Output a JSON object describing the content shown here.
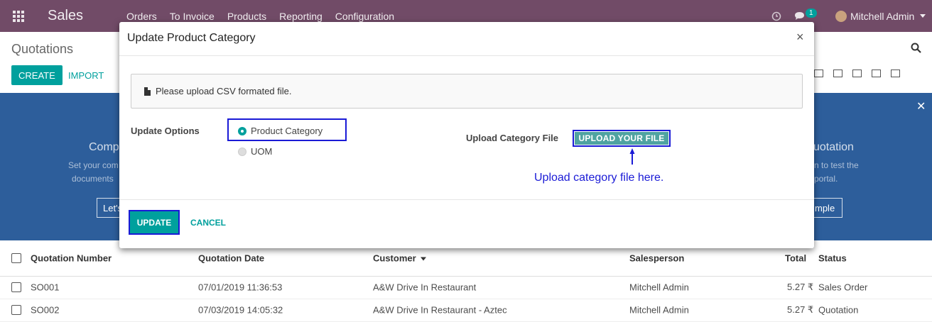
{
  "navbar": {
    "app_name": "Sales",
    "menu": [
      "Orders",
      "To Invoice",
      "Products",
      "Reporting",
      "Configuration"
    ],
    "chat_badge": "1",
    "user_name": "Mitchell Admin"
  },
  "control_panel": {
    "breadcrumb": "Quotations",
    "create_label": "CREATE",
    "import_label": "IMPORT"
  },
  "banner": {
    "left_title": "Comp",
    "left_text_1": "Set your com",
    "left_text_2": "documents",
    "left_button": "Let's",
    "right_title": "uotation",
    "right_text_1": "n to test the",
    "right_text_2": "portal.",
    "right_button": "mple"
  },
  "list": {
    "headers": [
      "Quotation Number",
      "Quotation Date",
      "Customer",
      "Salesperson",
      "Total",
      "Status"
    ],
    "rows": [
      {
        "number": "SO001",
        "date": "07/01/2019 11:36:53",
        "customer": "A&W Drive In Restaurant",
        "salesperson": "Mitchell Admin",
        "total": "5.27 ₹",
        "status": "Sales Order"
      },
      {
        "number": "SO002",
        "date": "07/03/2019 14:05:32",
        "customer": "A&W Drive In Restaurant - Aztec",
        "salesperson": "Mitchell Admin",
        "total": "5.27 ₹",
        "status": "Quotation"
      }
    ]
  },
  "modal": {
    "title": "Update Product Category",
    "close": "×",
    "alert_text": "Please upload CSV formated file.",
    "update_options_label": "Update Options",
    "option_product_category": "Product Category",
    "option_uom": "UOM",
    "upload_label": "Upload Category File",
    "upload_button": "UPLOAD YOUR FILE",
    "annotation": "Upload category file here.",
    "update_button": "UPDATE",
    "cancel_button": "CANCEL",
    "selected_option": "Product Category"
  },
  "colors": {
    "navbar": "#714b67",
    "primary": "#00a09d",
    "highlight": "#1a1ad6",
    "banner": "#2d5e9b"
  },
  "icons": [
    "apps-grid-icon",
    "clock-icon",
    "chat-icon",
    "search-icon",
    "kanban-view-icon",
    "calendar-view-icon",
    "pivot-view-icon",
    "graph-view-icon",
    "list-view-icon",
    "file-icon",
    "arrow-up-icon"
  ]
}
